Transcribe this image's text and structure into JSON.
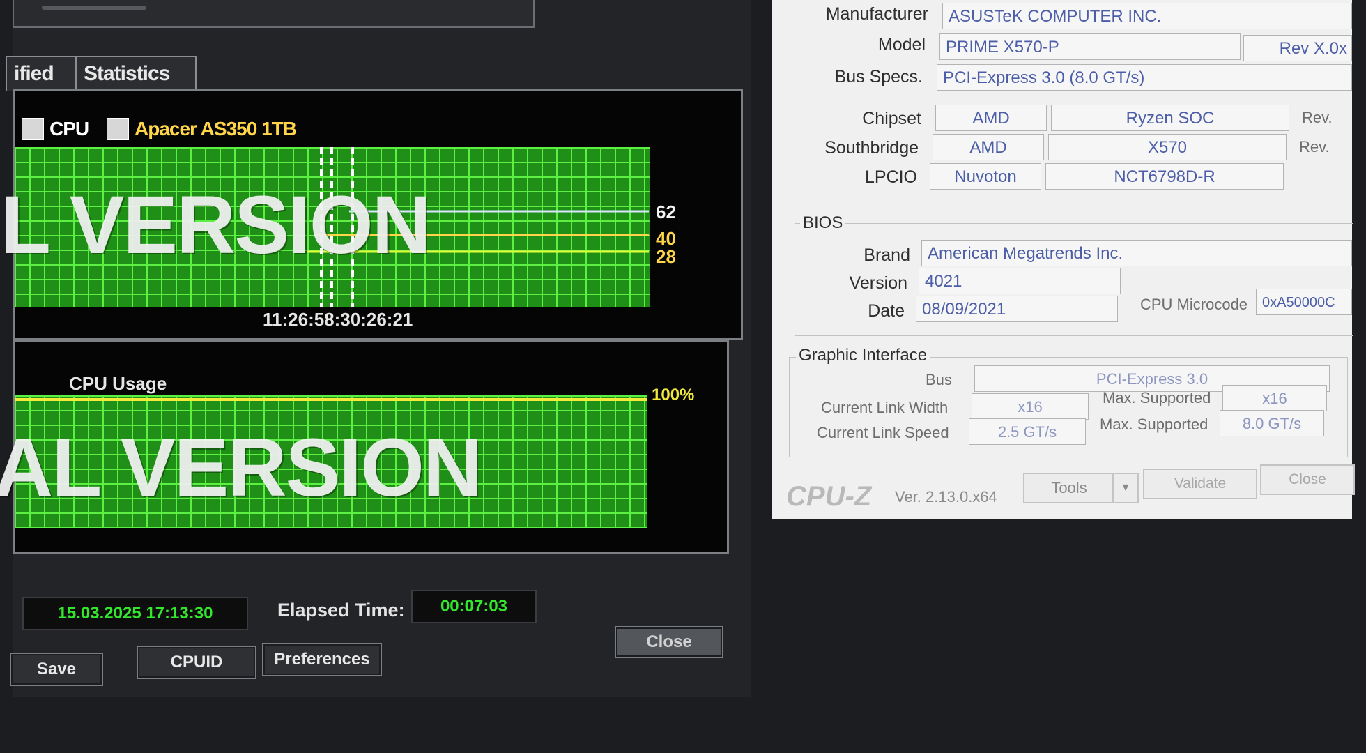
{
  "left_app": {
    "tabs": [
      "ified",
      "Statistics"
    ],
    "legend": [
      {
        "label": "CPU",
        "color": "#ffffff"
      },
      {
        "label": "Apacer AS350 1TB",
        "color": "#ffd54a"
      }
    ],
    "temperature_chart": {
      "watermark": "L VERSION",
      "labels": [
        "62",
        "40",
        "28"
      ],
      "time_label": "11:26:58:30:26:21"
    },
    "usage_chart": {
      "title": "CPU Usage",
      "max_label": "100%",
      "watermark": "AL VERSION"
    },
    "start_time": "15.03.2025 17:13:30",
    "elapsed_label": "Elapsed Time:",
    "elapsed_value": "00:07:03",
    "buttons": {
      "save": "Save",
      "cpuid": "CPUID",
      "preferences": "Preferences",
      "close": "Close"
    }
  },
  "cpuz": {
    "mainboard": {
      "manufacturer_label": "Manufacturer",
      "manufacturer": "ASUSTeK COMPUTER INC.",
      "model_label": "Model",
      "model": "PRIME X570-P",
      "model_rev": "Rev X.0x",
      "bus_label": "Bus Specs.",
      "bus": "PCI-Express 3.0 (8.0 GT/s)",
      "chipset_label": "Chipset",
      "chipset_vendor": "AMD",
      "chipset_name": "Ryzen SOC",
      "rev_label": "Rev.",
      "southbridge_label": "Southbridge",
      "southbridge_vendor": "AMD",
      "southbridge_name": "X570",
      "lpcio_label": "LPCIO",
      "lpcio_vendor": "Nuvoton",
      "lpcio_name": "NCT6798D-R"
    },
    "bios": {
      "title": "BIOS",
      "brand_label": "Brand",
      "brand": "American Megatrends Inc.",
      "version_label": "Version",
      "version": "4021",
      "date_label": "Date",
      "date": "08/09/2021",
      "microcode_label": "CPU Microcode",
      "microcode": "0xA50000C"
    },
    "graphic": {
      "title": "Graphic Interface",
      "bus_label": "Bus",
      "bus": "PCI-Express 3.0",
      "link_width_label": "Current Link Width",
      "link_width": "x16",
      "max_supported_label": "Max. Supported",
      "max_width": "x16",
      "link_speed_label": "Current Link Speed",
      "link_speed": "2.5 GT/s",
      "max_speed": "8.0 GT/s"
    },
    "footer": {
      "logo": "CPU-Z",
      "version": "Ver. 2.13.0.x64",
      "tools": "Tools",
      "validate": "Validate",
      "close": "Close"
    }
  }
}
